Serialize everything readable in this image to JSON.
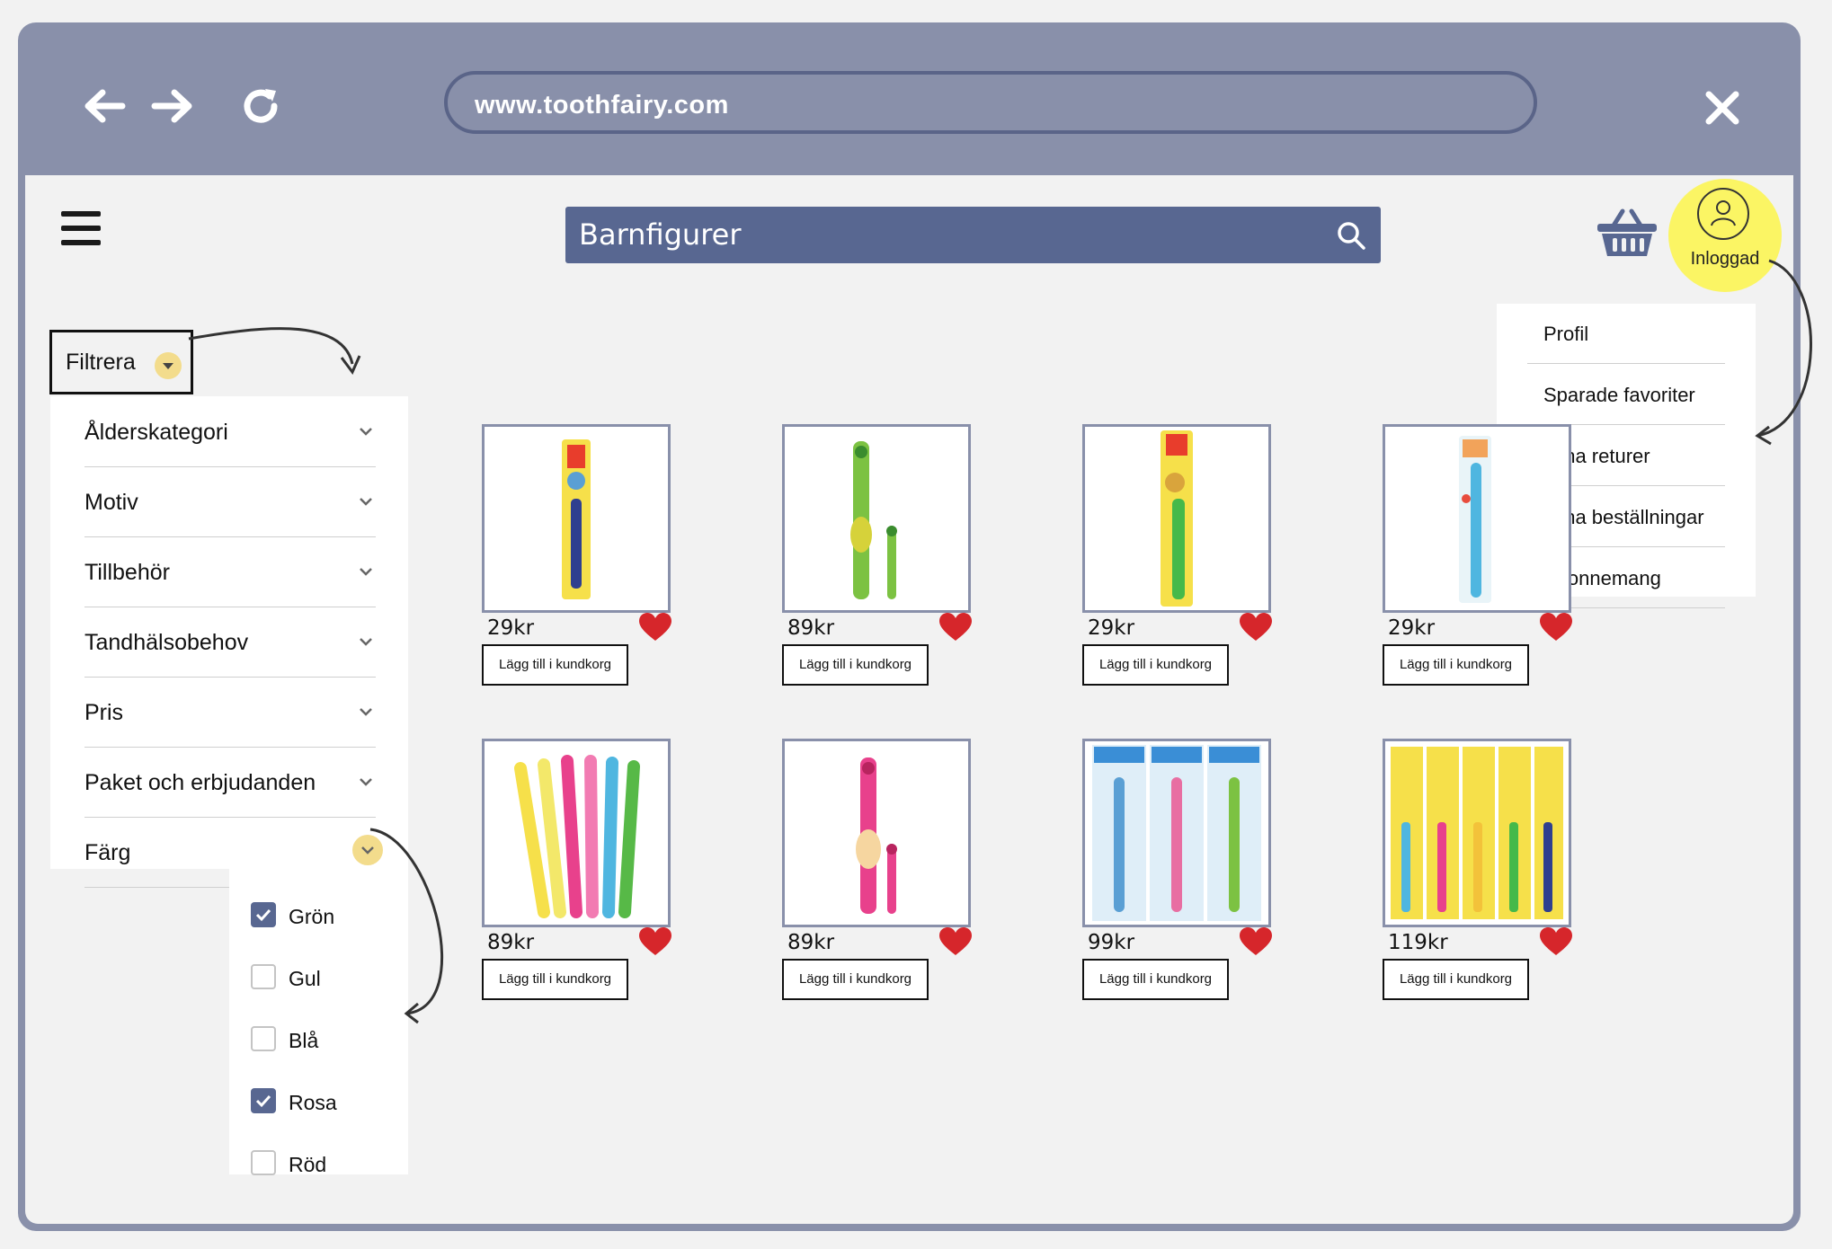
{
  "browser": {
    "url": "www.toothfairy.com",
    "back_icon": "back-arrow-icon",
    "forward_icon": "forward-arrow-icon",
    "reload_icon": "reload-icon",
    "close_icon": "close-icon"
  },
  "header": {
    "search": {
      "value": "Barnfigurer",
      "icon": "search-icon"
    },
    "basket_icon": "basket-icon",
    "login": {
      "label": "Inloggad",
      "icon": "user-icon",
      "color": "#fbf564"
    }
  },
  "user_menu": {
    "items": [
      "Profil",
      "Sparade favoriter",
      "Mina returer",
      "Mina beställningar",
      "Abonnemang"
    ]
  },
  "filter": {
    "button_label": "Filtrera",
    "categories": [
      "Ålderskategori",
      "Motiv",
      "Tillbehör",
      "Tandhälsobehov",
      "Pris",
      "Paket och erbjudanden",
      "Färg"
    ],
    "colors": [
      {
        "label": "Grön",
        "checked": true
      },
      {
        "label": "Gul",
        "checked": false
      },
      {
        "label": "Blå",
        "checked": true
      },
      {
        "label": "Rosa",
        "checked": true
      },
      {
        "label": "Röd",
        "checked": false
      }
    ]
  },
  "products": [
    {
      "price": "29kr",
      "button": "Lägg till i kundkorg",
      "image": "toothbrush-yellow-blue-pack"
    },
    {
      "price": "89kr",
      "button": "Lägg till i kundkorg",
      "image": "electric-toothbrush-green"
    },
    {
      "price": "29kr",
      "button": "Lägg till i kundkorg",
      "image": "toothbrush-yellow-green-pack"
    },
    {
      "price": "29kr",
      "button": "Lägg till i kundkorg",
      "image": "toothbrush-blue-pack"
    },
    {
      "price": "89kr",
      "button": "Lägg till i kundkorg",
      "image": "toothbrushes-multicolor"
    },
    {
      "price": "89kr",
      "button": "Lägg till i kundkorg",
      "image": "electric-toothbrush-pink"
    },
    {
      "price": "99kr",
      "button": "Lägg till i kundkorg",
      "image": "kids-toothbrush-3-pack"
    },
    {
      "price": "119kr",
      "button": "Lägg till i kundkorg",
      "image": "toothbrush-5-pack"
    }
  ],
  "colors": {
    "frame": "#8990aa",
    "search_bg": "#586791",
    "heart": "#d6262b",
    "highlight": "#fbf564",
    "caret_bg": "#f3dc8c"
  }
}
